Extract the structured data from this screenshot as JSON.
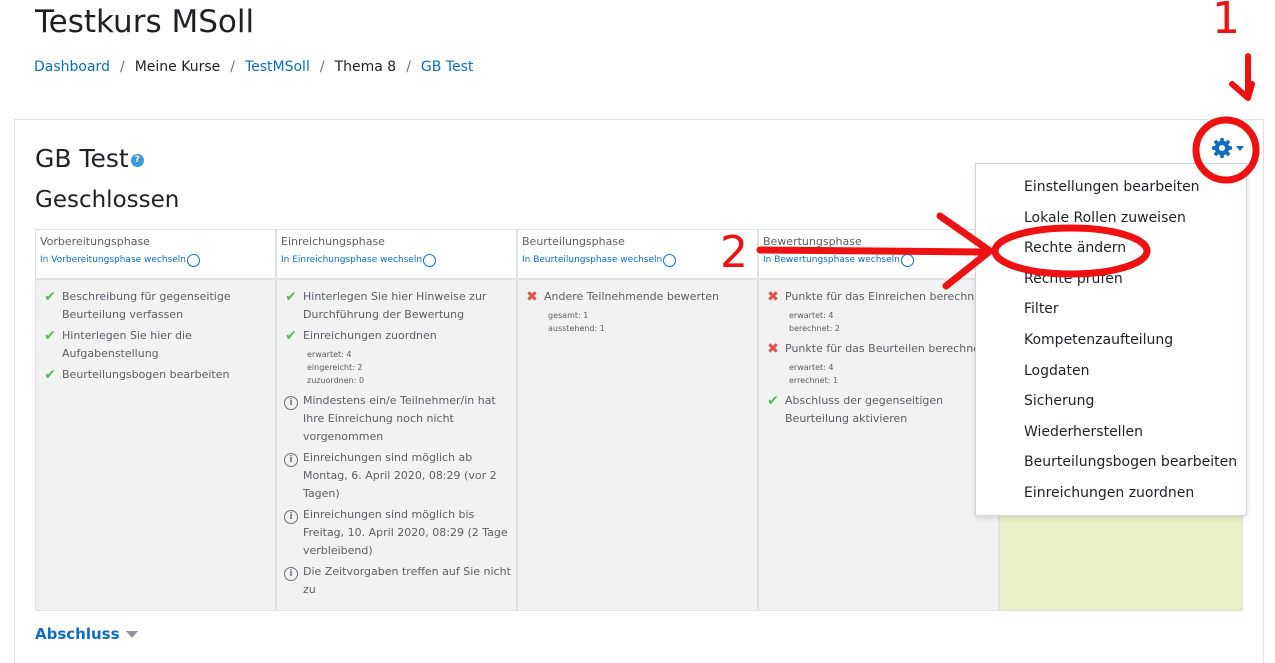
{
  "page": {
    "course_title": "Testkurs MSoll",
    "breadcrumb": [
      {
        "label": "Dashboard",
        "link": true
      },
      {
        "label": "Meine Kurse",
        "link": false
      },
      {
        "label": "TestMSoll",
        "link": true
      },
      {
        "label": "Thema 8",
        "link": false
      },
      {
        "label": "GB Test",
        "link": true
      }
    ],
    "separator": "/"
  },
  "activity": {
    "title": "GB Test",
    "help_icon": "?",
    "status": "Geschlossen"
  },
  "phases": [
    {
      "name": "Vorbereitungsphase",
      "switch_label": "In Vorbereitungsphase wechseln",
      "tasks": [
        {
          "icon": "check",
          "text": "Beschreibung für gegenseitige Beurteilung verfassen"
        },
        {
          "icon": "check",
          "text": "Hinterlegen Sie hier die Aufgabenstellung"
        },
        {
          "icon": "check",
          "text": "Beurteilungsbogen bearbeiten"
        }
      ]
    },
    {
      "name": "Einreichungsphase",
      "switch_label": "In Einreichungsphase wechseln",
      "tasks": [
        {
          "icon": "check",
          "text": "Hinterlegen Sie hier Hinweise zur Durchführung der Bewertung"
        },
        {
          "icon": "check",
          "text": "Einreichungen zuordnen",
          "details": [
            "erwartet: 4",
            "eingereicht: 2",
            "zuzuordnen: 0"
          ]
        },
        {
          "icon": "info",
          "text": "Mindestens ein/e Teilnehmer/in hat Ihre Einreichung noch nicht vorgenommen"
        },
        {
          "icon": "info",
          "text": "Einreichungen sind möglich ab Montag, 6. April 2020, 08:29 (vor 2 Tagen)"
        },
        {
          "icon": "info",
          "text": "Einreichungen sind möglich bis Freitag, 10. April 2020, 08:29 (2 Tage verbleibend)"
        },
        {
          "icon": "info",
          "text": "Die Zeitvorgaben treffen auf Sie nicht zu"
        }
      ]
    },
    {
      "name": "Beurteilungsphase",
      "switch_label": "In Beurteilungsphase wechseln",
      "tasks": [
        {
          "icon": "cross",
          "text": "Andere Teilnehmende bewerten",
          "details": [
            "gesamt: 1",
            "ausstehend: 1"
          ]
        }
      ]
    },
    {
      "name": "Bewertungsphase",
      "switch_label": "In Bewertungsphase wechseln",
      "tasks": [
        {
          "icon": "cross",
          "text": "Punkte für das Einreichen berechnen",
          "details": [
            "erwartet: 4",
            "berechnet: 2"
          ]
        },
        {
          "icon": "cross",
          "text": "Punkte für das Beurteilen berechnen",
          "details": [
            "erwartet: 4",
            "errechnet: 1"
          ]
        },
        {
          "icon": "check",
          "text": "Abschluss der gegenseitigen Beurteilung aktivieren"
        }
      ]
    }
  ],
  "icons": {
    "check": "✔",
    "cross": "✖",
    "info": "i"
  },
  "menu": {
    "items": [
      "Einstellungen bearbeiten",
      "Lokale Rollen zuweisen",
      "Rechte ändern",
      "Rechte prüfen",
      "Filter",
      "Kompetenzaufteilung",
      "Logdaten",
      "Sicherung",
      "Wiederherstellen",
      "Beurteilungsbogen bearbeiten",
      "Einreichungen zuordnen"
    ]
  },
  "annotations": {
    "marker_1": "1",
    "marker_2": "2",
    "color": "#ee1111"
  },
  "footer": {
    "link": "Abschluss"
  },
  "colors": {
    "link": "#0f6cbf",
    "active_phase": "#e8f0c8",
    "inactive_phase": "#f2f2f2",
    "check": "#5cb85c",
    "cross": "#d9534f"
  }
}
